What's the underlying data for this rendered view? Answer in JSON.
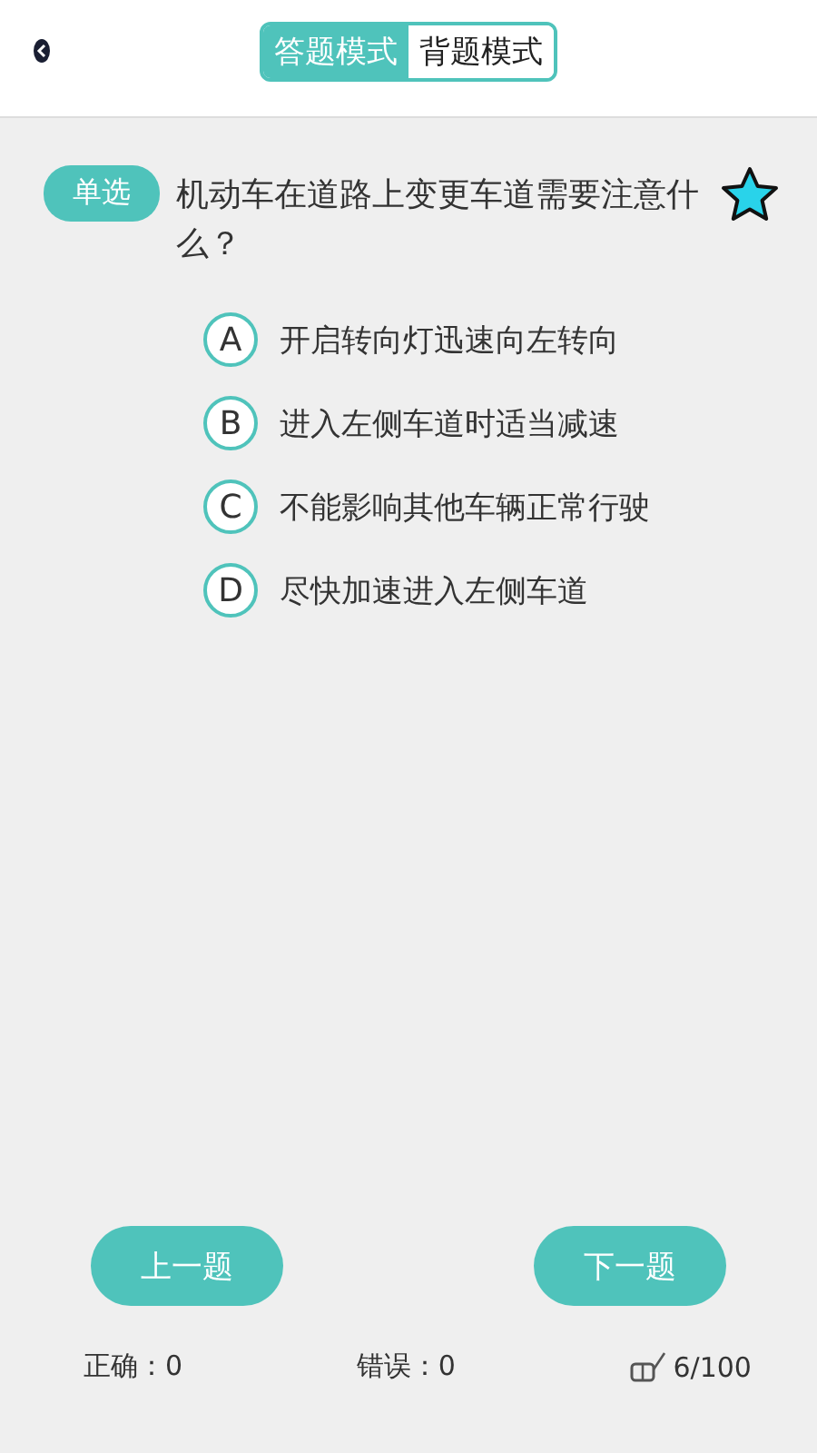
{
  "header": {
    "modes": [
      {
        "label": "答题模式",
        "selected": true
      },
      {
        "label": "背题模式",
        "selected": false
      }
    ]
  },
  "question": {
    "type_tag": "单选",
    "text": "机动车在道路上变更车道需要注意什么？",
    "favorited": true,
    "options": [
      {
        "letter": "A",
        "text": "开启转向灯迅速向左转向",
        "selected": false
      },
      {
        "letter": "B",
        "text": "进入左侧车道时适当减速",
        "selected": false
      },
      {
        "letter": "C",
        "text": "不能影响其他车辆正常行驶",
        "selected": false
      },
      {
        "letter": "D",
        "text": "尽快加速进入左侧车道",
        "selected": false
      }
    ]
  },
  "nav": {
    "prev": "上一题",
    "next": "下一题"
  },
  "stats": {
    "correct": "正确：0",
    "wrong": "错误：0",
    "progress": "6/100"
  }
}
